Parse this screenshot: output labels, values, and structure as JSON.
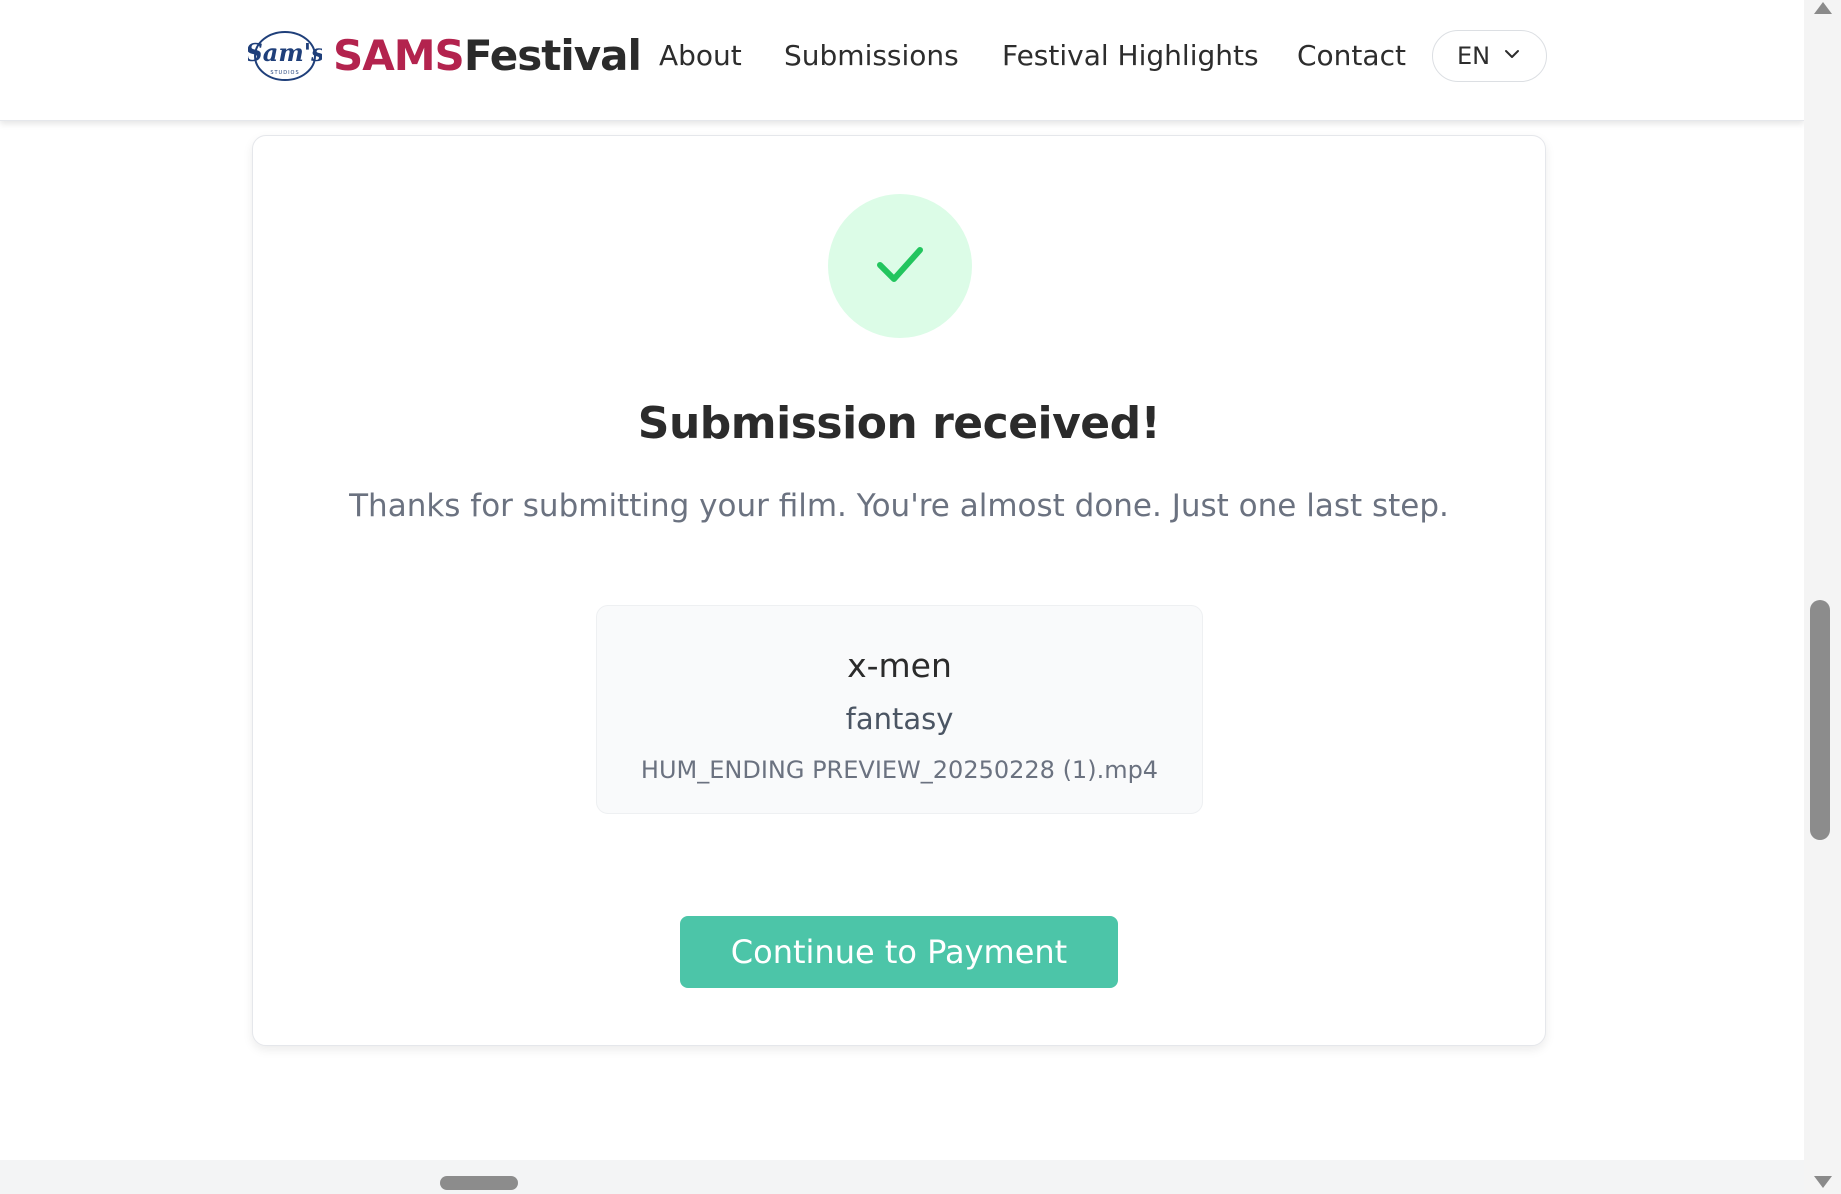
{
  "header": {
    "brand_part1": "SAMS",
    "brand_part2": "Festival",
    "logo_text": "Sam's",
    "nav": [
      {
        "label": "About"
      },
      {
        "label": "Submissions"
      },
      {
        "label": "Festival Highlights"
      },
      {
        "label": "Contact"
      }
    ],
    "language": "EN"
  },
  "confirmation": {
    "icon": "check-icon",
    "title": "Submission received!",
    "message": "Thanks for submitting your film. You're almost done. Just one last step."
  },
  "submission": {
    "film_title": "x-men",
    "genre": "fantasy",
    "file_name": "HUM_ENDING PREVIEW_20250228 (1).mp4"
  },
  "actions": {
    "continue_label": "Continue to Payment"
  },
  "colors": {
    "brand_accent": "#b3234e",
    "success_bg": "#dcfce7",
    "success_check": "#22c55e",
    "button": "#4cc5a8"
  }
}
